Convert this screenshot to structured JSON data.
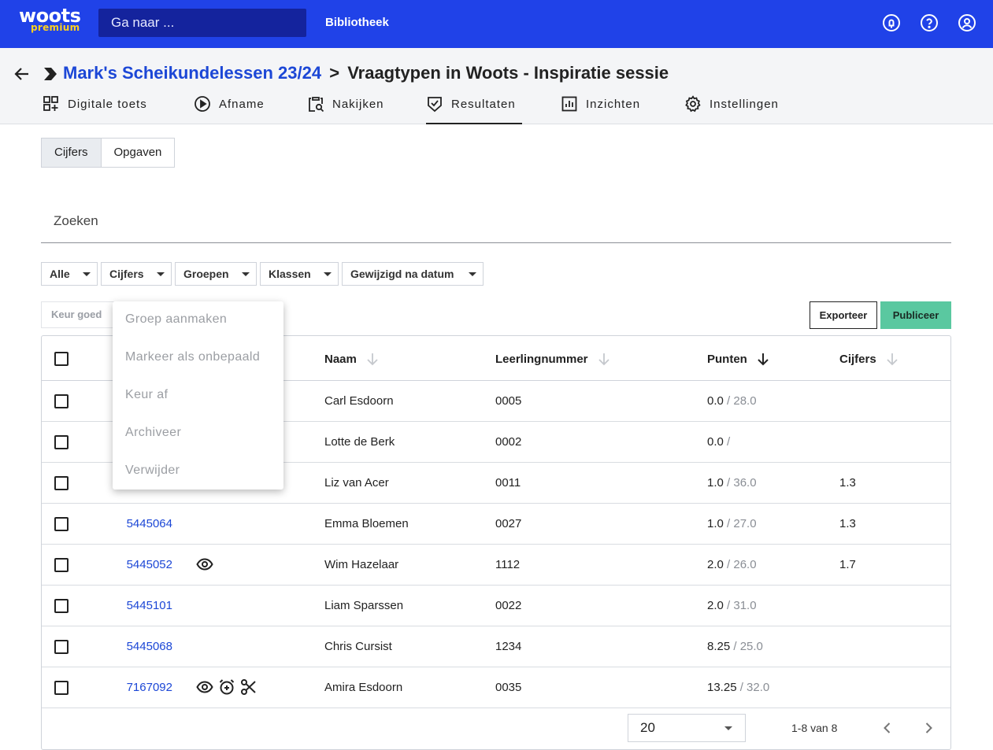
{
  "topbar": {
    "logo_text": "woots",
    "logo_sub": "premium",
    "search_placeholder": "Ga naar ...",
    "library_link": "Bibliotheek",
    "icons": [
      "notification-icon",
      "help-icon",
      "account-icon"
    ]
  },
  "breadcrumb": {
    "course": "Mark's Scheikundelessen 23/24",
    "separator": ">",
    "current": "Vraagtypen in Woots - Inspiratie sessie"
  },
  "tabs": [
    {
      "label": "Digitale toets",
      "icon": "grid-plus-icon"
    },
    {
      "label": "Afname",
      "icon": "play-circle-icon"
    },
    {
      "label": "Nakijken",
      "icon": "clipboard-search-icon"
    },
    {
      "label": "Resultaten",
      "icon": "shield-check-icon",
      "active": true
    },
    {
      "label": "Inzichten",
      "icon": "bar-chart-icon"
    },
    {
      "label": "Instellingen",
      "icon": "gear-icon"
    }
  ],
  "segmented": {
    "left": "Cijfers",
    "right": "Opgaven",
    "selected": "Cijfers"
  },
  "search": {
    "placeholder": "Zoeken"
  },
  "filters": [
    "Alle",
    "Cijfers",
    "Groepen",
    "Klassen",
    "Gewijzigd na datum"
  ],
  "actions": {
    "approve": "Keur goed",
    "export": "Exporteer",
    "publish": "Publiceer"
  },
  "dropdown_menu": [
    "Groep aanmaken",
    "Markeer als onbepaald",
    "Keur af",
    "Archiveer",
    "Verwijder"
  ],
  "table": {
    "columns": {
      "name": "Naam",
      "student_number": "Leerlingnummer",
      "points": "Punten",
      "grades": "Cijfers"
    },
    "rows": [
      {
        "id": "",
        "name": "Carl Esdoorn",
        "number": "0005",
        "points": "0.0",
        "max": "/ 28.0",
        "grade": ""
      },
      {
        "id": "",
        "name": "Lotte de Berk",
        "number": "0002",
        "points": "0.0",
        "max": "/",
        "grade": ""
      },
      {
        "id": "",
        "name": "Liz van Acer",
        "number": "0011",
        "points": "1.0",
        "max": "/ 36.0",
        "grade": "1.3"
      },
      {
        "id": "5445064",
        "name": "Emma Bloemen",
        "number": "0027",
        "points": "1.0",
        "max": "/ 27.0",
        "grade": "1.3"
      },
      {
        "id": "5445052",
        "name": "Wim Hazelaar",
        "number": "1112",
        "points": "2.0",
        "max": "/ 26.0",
        "grade": "1.7"
      },
      {
        "id": "5445101",
        "name": "Liam Sparssen",
        "number": "0022",
        "points": "2.0",
        "max": "/ 31.0",
        "grade": ""
      },
      {
        "id": "5445068",
        "name": "Chris Cursist",
        "number": "1234",
        "points": "8.25",
        "max": "/ 25.0",
        "grade": ""
      },
      {
        "id": "7167092",
        "name": "Amira Esdoorn",
        "number": "0035",
        "points": "13.25",
        "max": "/ 32.0",
        "grade": ""
      }
    ]
  },
  "pagination": {
    "page_size": "20",
    "range": "1-8 van 8"
  }
}
